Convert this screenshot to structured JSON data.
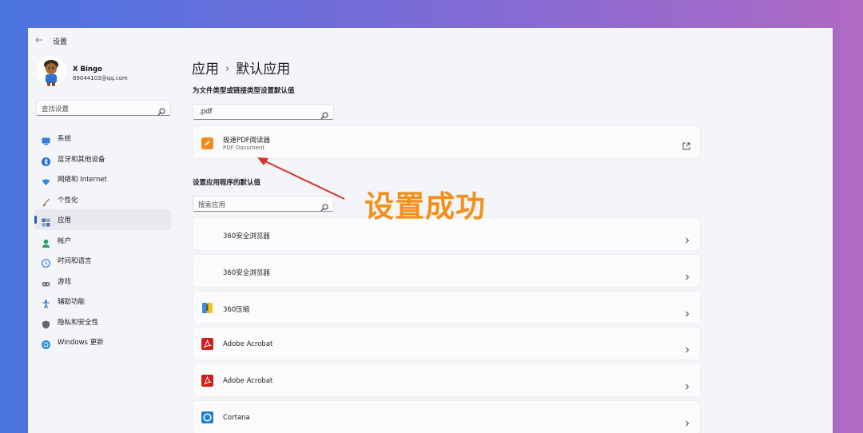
{
  "window": {
    "title": "设置"
  },
  "profile": {
    "name": "X Bingo",
    "email": "89044103@qq.com"
  },
  "sidebar": {
    "search_placeholder": "查找设置",
    "items": [
      {
        "label": "系统",
        "icon": "monitor-icon",
        "color": "#2f7fd4"
      },
      {
        "label": "蓝牙和其他设备",
        "icon": "bluetooth-icon",
        "color": "#1f6fd0"
      },
      {
        "label": "网络和 Internet",
        "icon": "wifi-icon",
        "color": "#2a8fe0"
      },
      {
        "label": "个性化",
        "icon": "brush-icon",
        "color": "#c96a2a"
      },
      {
        "label": "应用",
        "icon": "apps-icon",
        "color": "#4a6fa8",
        "active": true
      },
      {
        "label": "帐户",
        "icon": "user-icon",
        "color": "#2aa06a"
      },
      {
        "label": "时间和语言",
        "icon": "globe-clock-icon",
        "color": "#2f7fd4"
      },
      {
        "label": "游戏",
        "icon": "gamepad-icon",
        "color": "#777777"
      },
      {
        "label": "辅助功能",
        "icon": "accessibility-icon",
        "color": "#2a6fc4"
      },
      {
        "label": "隐私和安全性",
        "icon": "shield-icon",
        "color": "#666666"
      },
      {
        "label": "Windows 更新",
        "icon": "update-icon",
        "color": "#2a8fe0"
      }
    ]
  },
  "breadcrumb": {
    "parent": "应用",
    "separator": "›",
    "current": "默认应用"
  },
  "file_type_section": {
    "label": "为文件类型或链接类型设置默认值",
    "search_value": ".pdf",
    "result": {
      "title": "极速PDF阅读器",
      "subtitle": "PDF Document",
      "icon": "pdf-reader-icon",
      "color": "#f08a1c"
    }
  },
  "apps_section": {
    "label": "设置应用程序的默认值",
    "search_placeholder": "搜索应用",
    "apps": [
      {
        "name": "360安全浏览器",
        "icon": "none"
      },
      {
        "name": "360安全浏览器",
        "icon": "none"
      },
      {
        "name": "360压缩",
        "icon": "archive-icon",
        "color": "#3a8fd8"
      },
      {
        "name": "Adobe Acrobat",
        "icon": "acrobat-icon",
        "color": "#c8211f"
      },
      {
        "name": "Adobe Acrobat",
        "icon": "acrobat-icon",
        "color": "#c8211f"
      },
      {
        "name": "Cortana",
        "icon": "cortana-icon",
        "color": "#1f7fd8"
      }
    ]
  },
  "annotation": {
    "text": "设置成功",
    "color": "#f2901c",
    "arrow_color": "#d8322a"
  }
}
